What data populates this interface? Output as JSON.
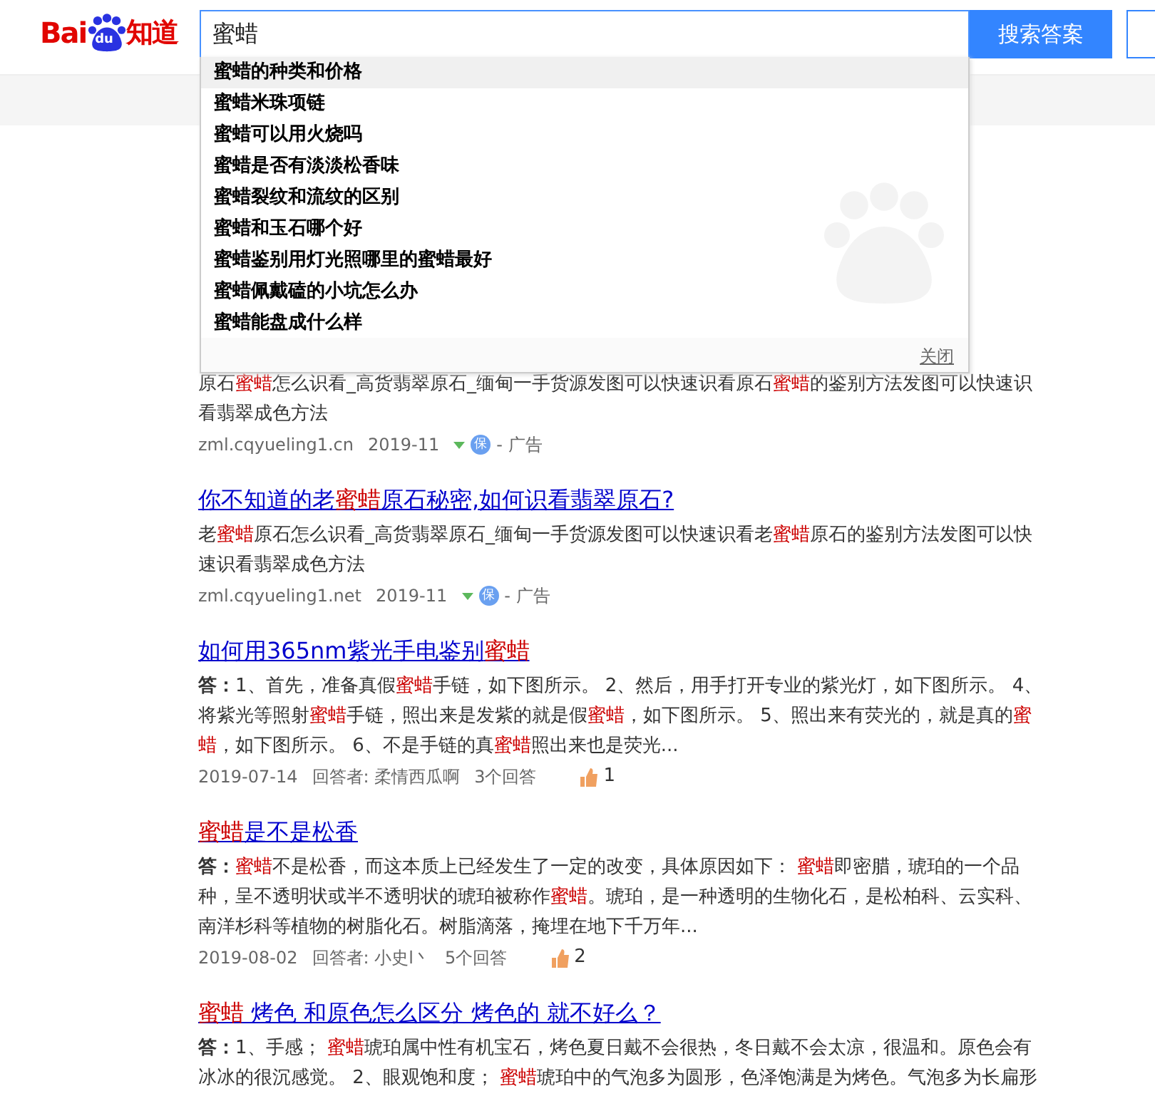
{
  "logo": {
    "part1": "Bai",
    "part2": "du",
    "part3": "知道"
  },
  "search": {
    "value": "蜜蜡",
    "button": "搜索答案"
  },
  "suggestions": {
    "items": [
      {
        "text": "蜜蜡的种类和价格",
        "selected": true
      },
      {
        "text": "蜜蜡米珠项链",
        "selected": false
      },
      {
        "text": "蜜蜡可以用火烧吗",
        "selected": false
      },
      {
        "text": "蜜蜡是否有淡淡松香味",
        "selected": false
      },
      {
        "text": "蜜蜡裂纹和流纹的区别",
        "selected": false
      },
      {
        "text": "蜜蜡和玉石哪个好",
        "selected": false
      },
      {
        "text": "蜜蜡鉴别用灯光照哪里的蜜蜡最好",
        "selected": false
      },
      {
        "text": "蜜蜡佩戴磕的小坑怎么办",
        "selected": false
      },
      {
        "text": "蜜蜡能盘成什么样",
        "selected": false
      }
    ],
    "close": "关闭"
  },
  "results": [
    {
      "kind": "ad",
      "snippet": [
        {
          "text": "原石",
          "highlight": false
        },
        {
          "text": "蜜蜡",
          "highlight": true
        },
        {
          "text": "怎么识看_高货翡翠原石_缅甸一手货源发图可以快速识看原石",
          "highlight": false
        },
        {
          "text": "蜜蜡",
          "highlight": true
        },
        {
          "text": "的鉴别方法发图可以快速识看翡翠成色方法",
          "highlight": false
        }
      ],
      "url": "zml.cqyueling1.cn",
      "date": "2019-11",
      "badge": "保",
      "ad_label": "- 广告"
    },
    {
      "kind": "ad",
      "title": [
        {
          "text": "你不知道的老",
          "highlight": false
        },
        {
          "text": "蜜蜡",
          "highlight": true
        },
        {
          "text": "原石秘密,如何识看翡翠原石?",
          "highlight": false
        }
      ],
      "snippet": [
        {
          "text": "老",
          "highlight": false
        },
        {
          "text": "蜜蜡",
          "highlight": true
        },
        {
          "text": "原石怎么识看_高货翡翠原石_缅甸一手货源发图可以快速识看老",
          "highlight": false
        },
        {
          "text": "蜜蜡",
          "highlight": true
        },
        {
          "text": "原石的鉴别方法发图可以快速识看翡翠成色方法",
          "highlight": false
        }
      ],
      "url": "zml.cqyueling1.net",
      "date": "2019-11",
      "badge": "保",
      "ad_label": "- 广告"
    },
    {
      "kind": "qa",
      "title": [
        {
          "text": "如何用365nm紫光手电鉴别",
          "highlight": false
        },
        {
          "text": "蜜蜡",
          "highlight": true
        }
      ],
      "answer_label": "答：",
      "snippet": [
        {
          "text": "1、首先，准备真假",
          "highlight": false
        },
        {
          "text": "蜜蜡",
          "highlight": true
        },
        {
          "text": "手链，如下图所示。 2、然后，用手打开专业的紫光灯，如下图所示。 4、将紫光等照射",
          "highlight": false
        },
        {
          "text": "蜜蜡",
          "highlight": true
        },
        {
          "text": "手链，照出来是发紫的就是假",
          "highlight": false
        },
        {
          "text": "蜜蜡",
          "highlight": true
        },
        {
          "text": "，如下图所示。 5、照出来有荧光的，就是真的",
          "highlight": false
        },
        {
          "text": "蜜蜡",
          "highlight": true
        },
        {
          "text": "，如下图所示。 6、不是手链的真",
          "highlight": false
        },
        {
          "text": "蜜蜡",
          "highlight": true
        },
        {
          "text": "照出来也是荧光...",
          "highlight": false
        }
      ],
      "date": "2019-07-14",
      "answerer": "回答者: 柔情西瓜啊",
      "answer_count": "3个回答",
      "likes": "1"
    },
    {
      "kind": "qa",
      "title": [
        {
          "text": "蜜蜡",
          "highlight": true
        },
        {
          "text": "是不是松香",
          "highlight": false
        }
      ],
      "answer_label": "答：",
      "snippet": [
        {
          "text": "蜜蜡",
          "highlight": true
        },
        {
          "text": "不是松香，而这本质上已经发生了一定的改变，具体原因如下： ",
          "highlight": false
        },
        {
          "text": "蜜蜡",
          "highlight": true
        },
        {
          "text": "即密腊，琥珀的一个品种，呈不透明状或半不透明状的琥珀被称作",
          "highlight": false
        },
        {
          "text": "蜜蜡",
          "highlight": true
        },
        {
          "text": "。琥珀，是一种透明的生物化石，是松柏科、云实科、南洋杉科等植物的树脂化石。树脂滴落，掩埋在地下千万年...",
          "highlight": false
        }
      ],
      "date": "2019-08-02",
      "answerer": "回答者: 小史l丶",
      "answer_count": "5个回答",
      "likes": "2"
    },
    {
      "kind": "qa",
      "title": [
        {
          "text": "蜜蜡",
          "highlight": true
        },
        {
          "text": " 烤色 和原色怎么区分 烤色的 就不好么？",
          "highlight": false
        }
      ],
      "answer_label": "答：",
      "snippet": [
        {
          "text": "1、手感； ",
          "highlight": false
        },
        {
          "text": "蜜蜡",
          "highlight": true
        },
        {
          "text": "琥珀属中性有机宝石，烤色夏日戴不会很热，冬日戴不会太凉，很温和。原色会有冰冰的很沉感觉。 2、眼观饱和度； ",
          "highlight": false
        },
        {
          "text": "蜜蜡",
          "highlight": true
        },
        {
          "text": "琥珀中的气泡多为圆形，色泽饱满是为烤色。气泡多为长扁形",
          "highlight": false
        }
      ]
    }
  ]
}
